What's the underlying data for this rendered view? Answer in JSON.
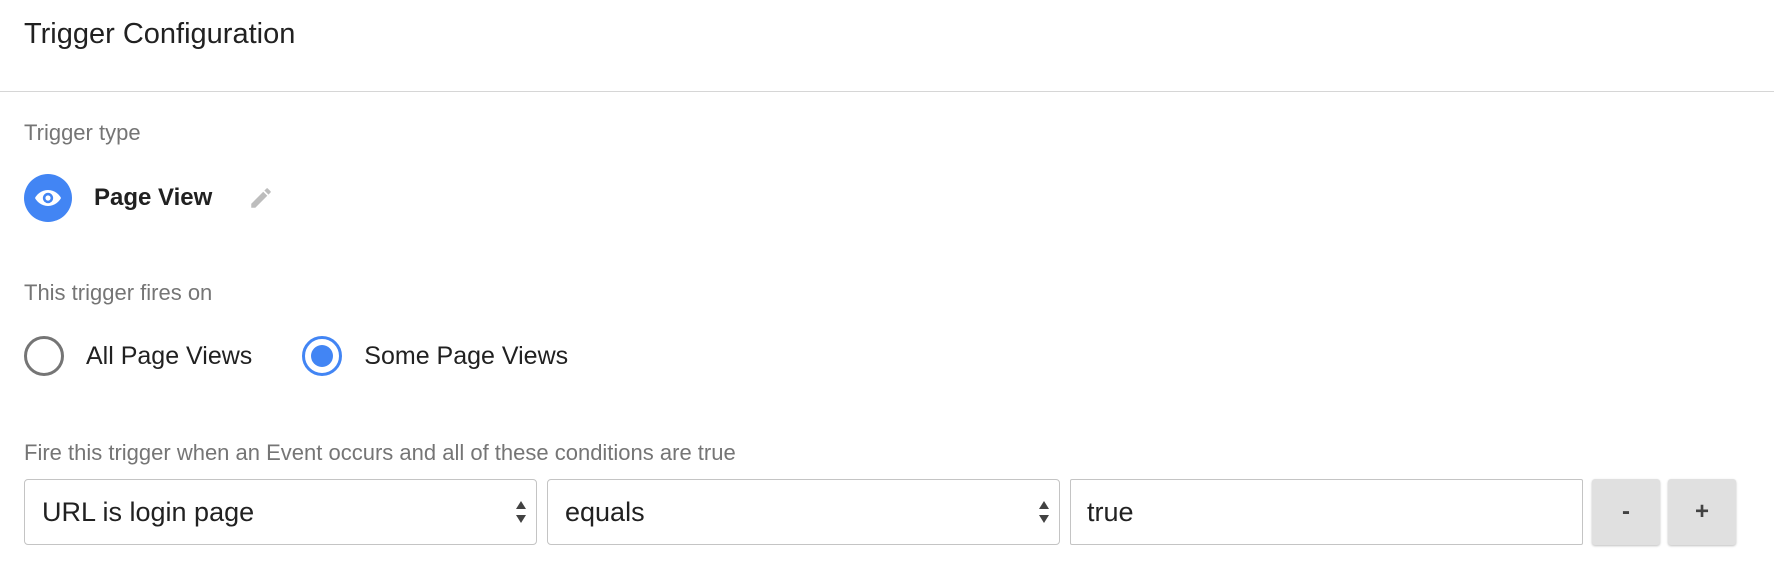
{
  "header": {
    "title": "Trigger Configuration"
  },
  "trigger_type": {
    "label": "Trigger type",
    "name": "Page View",
    "icon": "eye-icon",
    "icon_color": "#4285f4",
    "edit_icon": "pencil-icon"
  },
  "fires_on": {
    "label": "This trigger fires on",
    "options": [
      {
        "label": "All Page Views",
        "selected": false
      },
      {
        "label": "Some Page Views",
        "selected": true
      }
    ]
  },
  "conditions": {
    "label": "Fire this trigger when an Event occurs and all of these conditions are true",
    "rows": [
      {
        "variable": "URL is login page",
        "operator": "equals",
        "value": "true",
        "remove_label": "-",
        "add_label": "+"
      }
    ]
  },
  "colors": {
    "accent": "#4285f4",
    "divider": "#d6d6d6",
    "muted_text": "#757575",
    "button_bg": "#e0e0e0"
  }
}
